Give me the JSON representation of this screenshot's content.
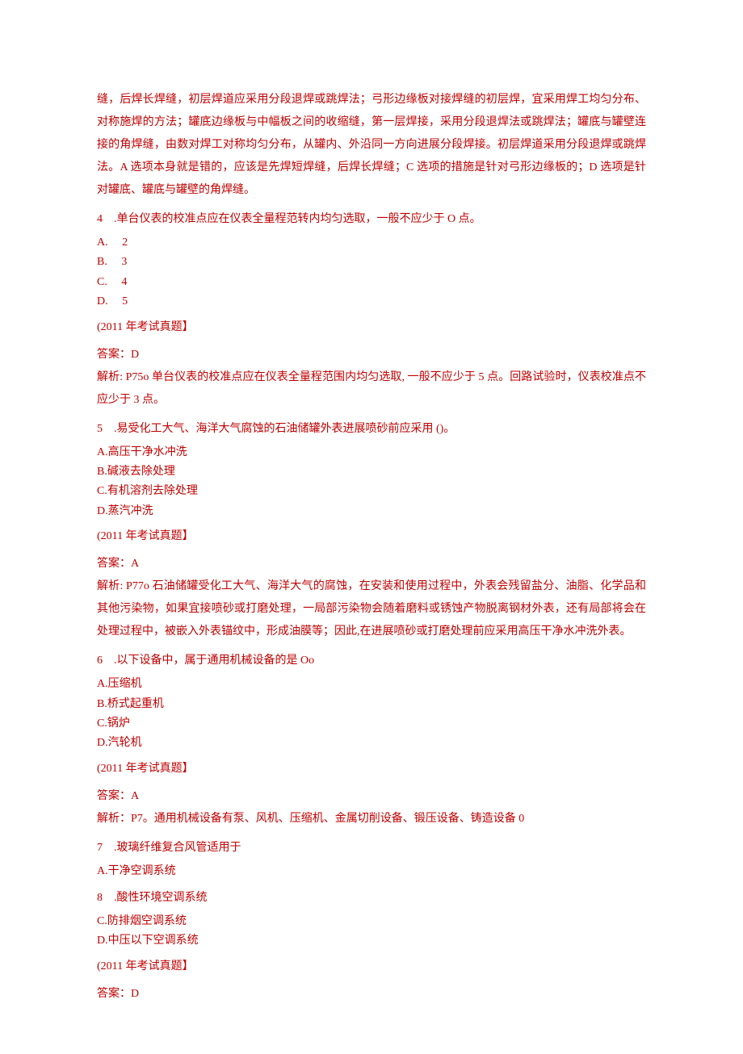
{
  "intro_para": "缝，后焊长焊缝，初层焊道应采用分段退焊或跳焊法；弓形边缘板对接焊缝的初层焊，宜采用焊工均匀分布、对称施焊的方法；罐底边缘板与中幅板之间的收缩缝，第一层焊接，采用分段退焊法或跳焊法；罐底与罐壁连接的角焊缝，由数对焊工对称均匀分布，从罐内、外沿同一方向进展分段焊接。初层焊道采用分段退焊或跳焊法。A 选项本身就是错的，应该是先焊短焊缝，后焊长焊缝；C 选项的措施是针对弓形边缘板的；D 选项是针对罐底、罐底与罐壁的角焊缝。",
  "q4": {
    "stem": "4　.单台仪表的校准点应在仪表全量程范转内均匀选取，一般不应少于 O 点。",
    "opts": {
      "a": "A.　 2",
      "b": "B.　 3",
      "c": "C.　 4",
      "d": "D.　 5"
    },
    "tag": "(2011 年考试真题】",
    "ans": "答案：D",
    "ana": "解析: P75o 单台仪表的校准点应在仪表全量程范围内均匀选取, 一般不应少于 5 点。回路试验时，仪表校准点不应少于 3 点。"
  },
  "q5": {
    "stem": "5　.易受化工大气、海洋大气腐蚀的石油储罐外表进展喷砂前应采用 ()。",
    "opts": {
      "a": "A.高压干净水冲洗",
      "b": "B.碱液去除处理",
      "c": "C.有机溶剂去除处理",
      "d": "D.蒸汽冲洗"
    },
    "tag": "(2011 年考试真题】",
    "ans": "答案：A",
    "ana": "解析: P77o 石油储罐受化工大气、海洋大气的腐蚀，在安装和使用过程中，外表会残留盐分、油脂、化学品和其他污染物，如果宜接喷砂或打磨处理，一局部污染物会随着磨料或锈蚀产物脱离钢材外表，还有局部将会在处理过程中，被嵌入外表锚纹中，形成油膜等；因此,在进展喷砂或打磨处理前应采用高压干净水冲洗外表。"
  },
  "q6": {
    "stem": "6　.以下设备中，属于通用机械设备的是 Oo",
    "opts": {
      "a": "A.压缩机",
      "b": "B.桥式起重机",
      "c": "C.锅炉",
      "d": "D.汽轮机"
    },
    "tag": "(2011 年考试真题】",
    "ans": "答案：A",
    "ana": "解析：P7。通用机械设备有泵、风机、压缩机、金属切削设备、锻压设备、铸造设备 0"
  },
  "q7": {
    "stem": "7　.玻璃纤维复合风管适用于",
    "opts": {
      "a": "A.干净空调系统",
      "b": "8　.酸性环境空调系统",
      "c": "C.防排烟空调系统",
      "d": "D.中压以下空调系统"
    },
    "tag": "(2011 年考试真题】",
    "ans": "答案：D"
  }
}
